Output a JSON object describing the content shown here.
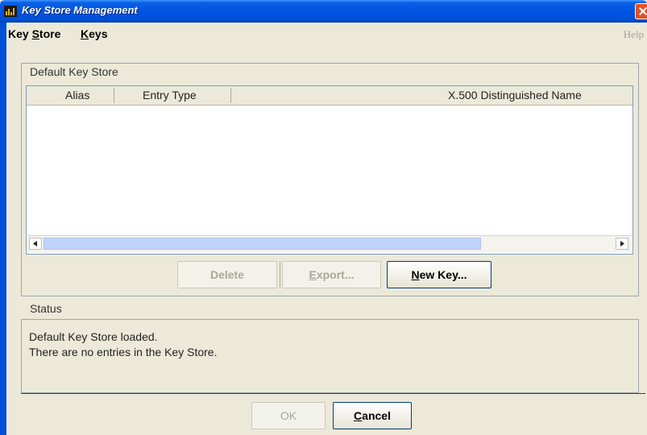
{
  "window": {
    "title": "Key Store Management"
  },
  "menubar": {
    "key_store": "Key Store",
    "keys": "Keys",
    "help": "Help"
  },
  "keystore_panel": {
    "title": "Default Key Store",
    "columns": [
      "Alias",
      "Entry Type",
      "X.500 Distinguished Name"
    ],
    "rows": []
  },
  "actions": {
    "delete": "Delete",
    "export": "Export...",
    "new_key": "New Key..."
  },
  "status_panel": {
    "title": "Status",
    "lines": [
      "Default Key Store loaded.",
      "There are no entries in the Key Store."
    ]
  },
  "footer": {
    "ok": "OK",
    "cancel": "Cancel"
  },
  "colors": {
    "titlebar": "#0054e3",
    "window_bg": "#ece9d8",
    "scroll_thumb": "#c1d3fb"
  }
}
